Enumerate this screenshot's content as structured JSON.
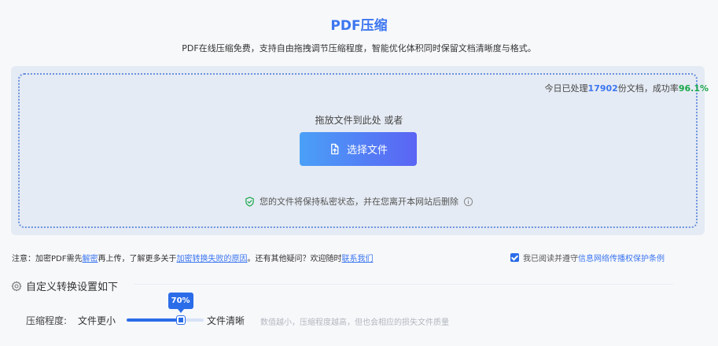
{
  "header": {
    "title": "PDF压缩",
    "subtitle": "PDF在线压缩免费，支持自由拖拽调节压缩程度，智能优化体积同时保留文档清晰度与格式。"
  },
  "upload": {
    "stats_prefix": "今日已处理",
    "stats_count": "17902",
    "stats_mid": "份文档，成功率",
    "stats_rate": "96.1%",
    "drop_hint": "拖放文件到此处 或者",
    "choose_button": "选择文件",
    "privacy_text": "您的文件将保持私密状态，并在您离开本网站后删除"
  },
  "notice": {
    "prefix": "注意：加密PDF需先",
    "decrypt_link": "解密",
    "middle": "再上传，了解更多关于",
    "reason_link": "加密转换失败的原因",
    "suffix": "。还有其他疑问？欢迎随时",
    "contact_link": "联系我们"
  },
  "agreement": {
    "prefix": "我已阅读并遵守",
    "link": "信息网络传播权保护条例",
    "checked": true
  },
  "settings": {
    "heading": "自定义转换设置如下",
    "level_label": "压缩程度:",
    "left_hint": "文件更小",
    "right_hint": "文件清晰",
    "slider_value": 0.7,
    "slider_label": "70%",
    "description": "数值越小，压缩程度越高，但也会相应的损失文件质量"
  },
  "colors": {
    "accent": "#3c76f0",
    "success": "#19a74a",
    "slider": "#2b6de8"
  },
  "icons": {
    "choose_button": "file-upload-icon",
    "privacy": "shield-check-icon",
    "privacy_info": "info-icon",
    "settings": "gear-icon",
    "agreement": "checkbox-checked-icon"
  }
}
